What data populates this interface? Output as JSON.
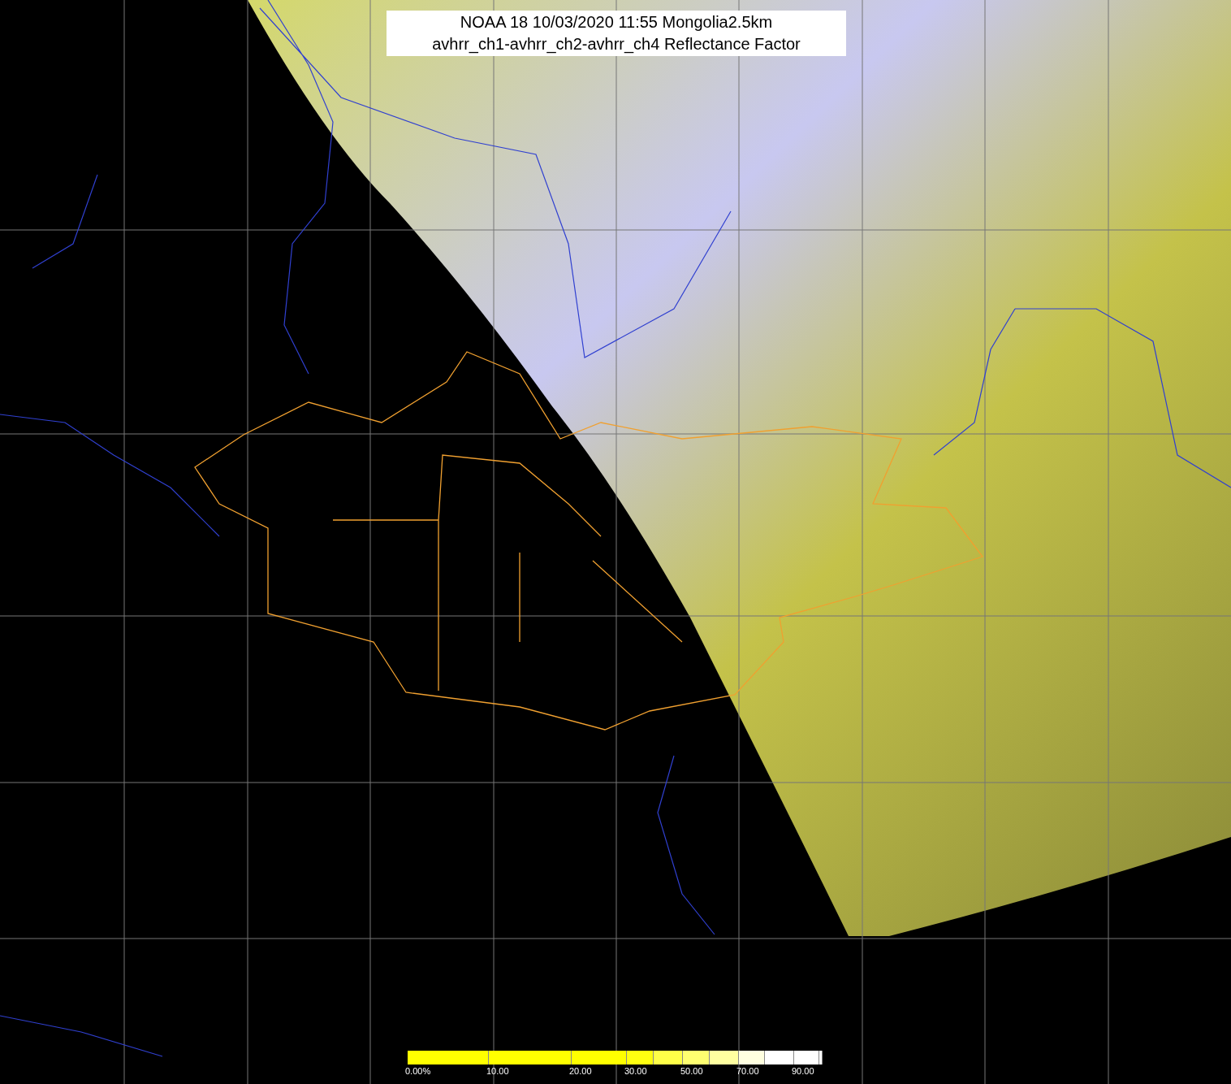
{
  "title": {
    "lines": [
      "NOAA 18 10/03/2020 11:55 Mongolia2.5km",
      "avhrr_ch1-avhrr_ch2-avhrr_ch4 Reflectance Factor"
    ]
  },
  "legend": {
    "segments": [
      {
        "color": "#ffff00",
        "label": "0.00%"
      },
      {
        "color": "#ffff00",
        "label": "10.00"
      },
      {
        "color": "#ffff00",
        "label": "20.00"
      },
      {
        "color": "#ffff10",
        "label": "30.00"
      },
      {
        "color": "#ffff48"
      },
      {
        "color": "#ffff70",
        "label": "50.00"
      },
      {
        "color": "#ffffa0"
      },
      {
        "color": "#ffffe0",
        "label": "70.00"
      },
      {
        "color": "#ffffff"
      },
      {
        "color": "#ffffff",
        "label": "90.00"
      },
      {
        "color": "#ffffff"
      }
    ]
  }
}
